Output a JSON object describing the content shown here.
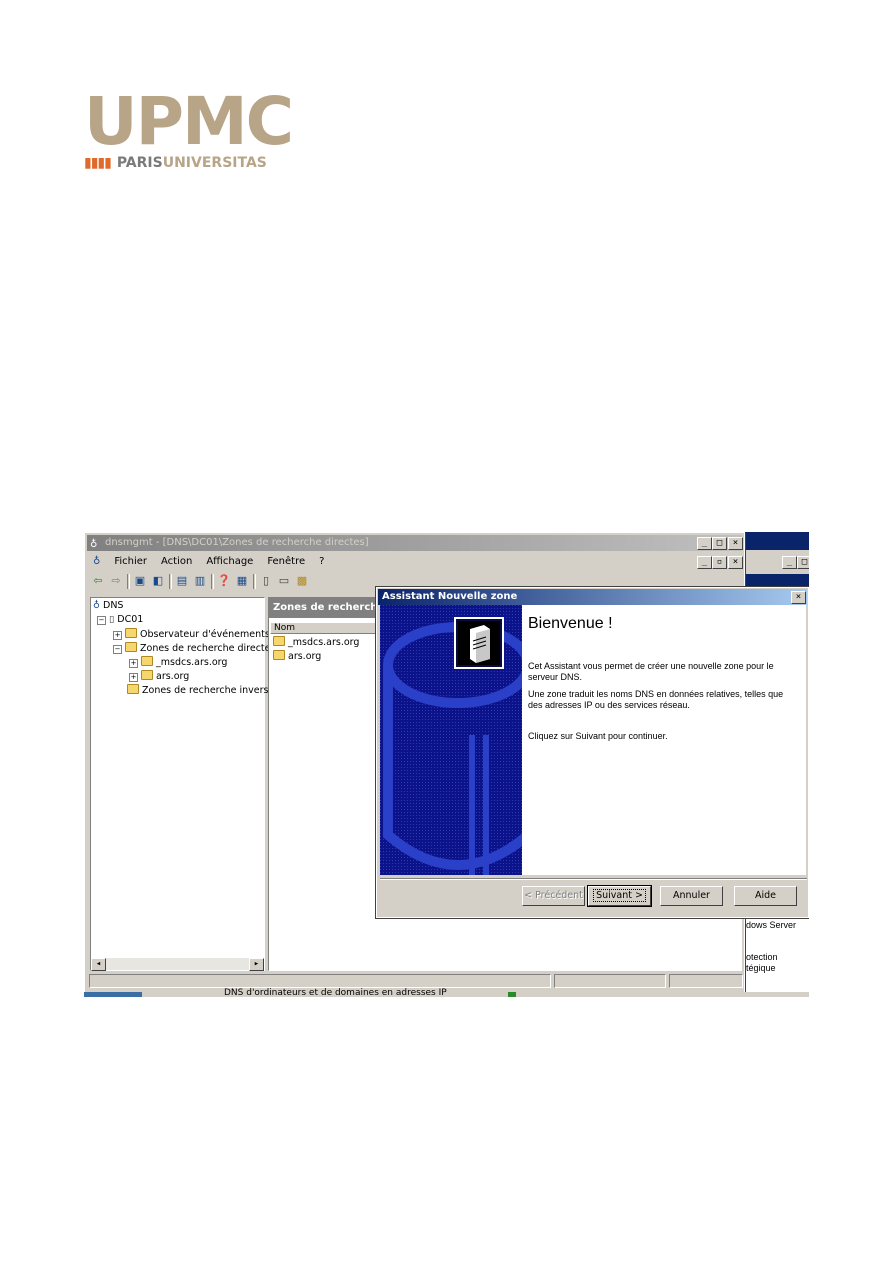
{
  "logo": {
    "wordmark": "UPMC",
    "sub_bars": "▮▮▮▮",
    "sub_paris": "PARIS",
    "sub_universitas": "UNIVERSITAS"
  },
  "mmc": {
    "title": "dnsmgmt - [DNS\\DC01\\Zones de recherche directes]",
    "title_buttons": [
      "_",
      "□",
      "×"
    ],
    "menu": [
      "Fichier",
      "Action",
      "Affichage",
      "Fenêtre",
      "?"
    ],
    "inner_buttons": [
      "_",
      "▫",
      "×"
    ],
    "tree": {
      "root": "DNS",
      "server": "DC01",
      "items": [
        "Observateur d'événements",
        "Zones de recherche directes",
        "_msdcs.ars.org",
        "ars.org",
        "Zones de recherche inversée"
      ]
    },
    "right_header": "Zones de recherche d",
    "column_name": "Nom",
    "list": [
      "_msdcs.ars.org",
      "ars.org"
    ],
    "taskbar_text": "DNS d'ordinateurs et de domaines en adresses IP"
  },
  "background_window": {
    "fragments": [
      "dows Server",
      "otection",
      "tégique"
    ]
  },
  "wizard": {
    "title": "Assistant Nouvelle zone",
    "close": "×",
    "heading": "Bienvenue !",
    "paragraphs": [
      "Cet Assistant vous permet de créer une nouvelle zone pour le serveur DNS.",
      "Une zone traduit les noms DNS en données relatives, telles que des adresses IP ou des services réseau.",
      "Cliquez sur Suivant pour continuer."
    ],
    "buttons": {
      "back": "< Précédent",
      "next": "Suivant >",
      "cancel": "Annuler",
      "help": "Aide"
    }
  },
  "colors": {
    "wizard_side": "#0c138a",
    "titlebar_active": "#0a246a",
    "logo_gold": "#b8a487",
    "logo_orange": "#e06a2c"
  }
}
